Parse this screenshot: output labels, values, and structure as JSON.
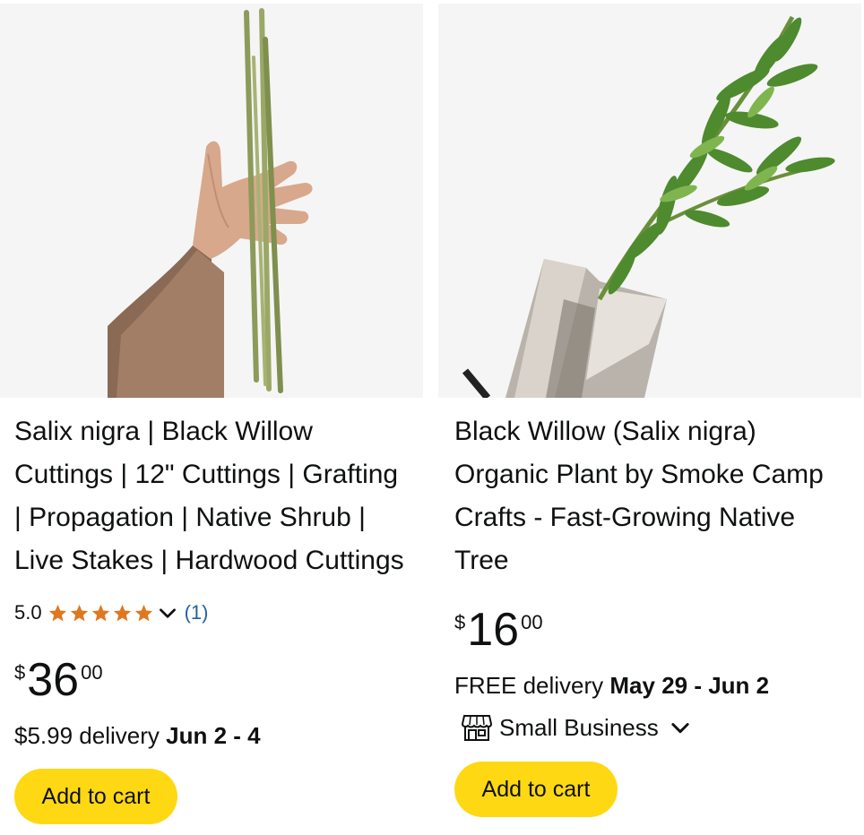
{
  "products": [
    {
      "title": "Salix nigra | Black Willow Cuttings | 12\" Cuttings | Grafting | Propagation | Native Shrub | Live Stakes | Hardwood Cuttings",
      "rating": "5.0",
      "review_count": "(1)",
      "stars": 5,
      "price_symbol": "$",
      "price_whole": "36",
      "price_fraction": "00",
      "delivery_prefix": "$5.99 delivery",
      "delivery_date": "Jun 2 - 4",
      "add_to_cart": "Add to cart"
    },
    {
      "title": "Black Willow (Salix nigra) Organic Plant by Smoke Camp Crafts - Fast-Growing Native Tree",
      "price_symbol": "$",
      "price_whole": "16",
      "price_fraction": "00",
      "delivery_prefix": "FREE delivery",
      "delivery_date": "May 29 - Jun 2",
      "badge": "Small Business",
      "add_to_cart": "Add to cart"
    }
  ],
  "colors": {
    "star": "#de7921",
    "link": "#2162a1",
    "button": "#ffd814",
    "image_bg": "#f5f5f5"
  },
  "icons": [
    "star-icon",
    "chevron-down-icon",
    "store-icon"
  ]
}
